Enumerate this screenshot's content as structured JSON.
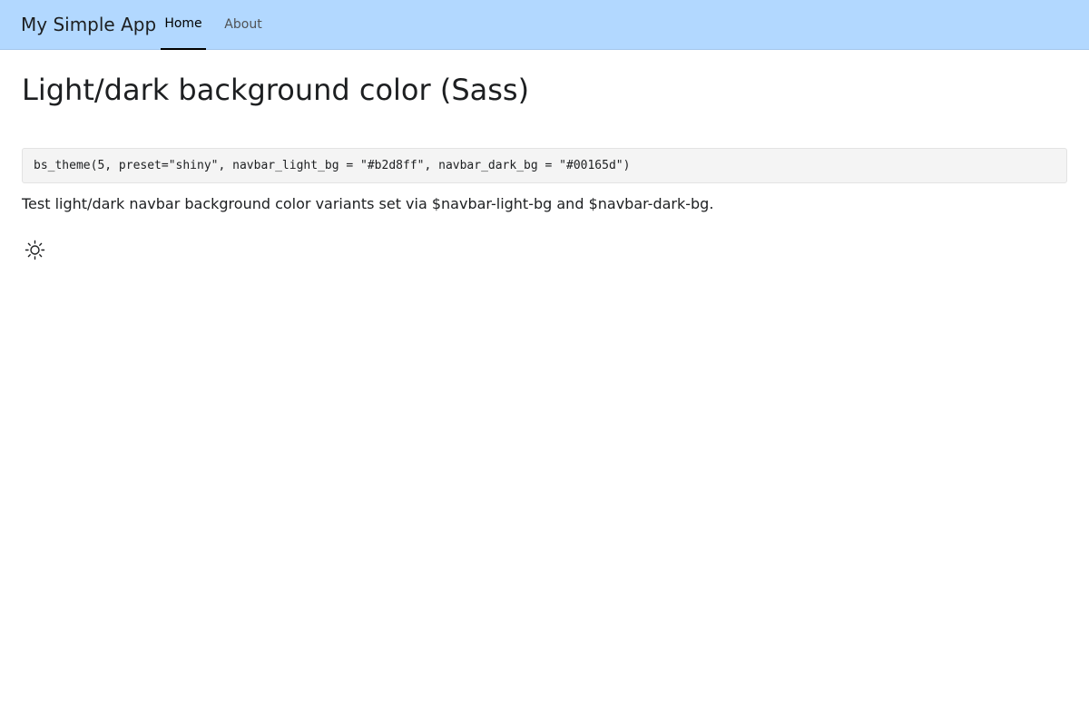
{
  "navbar": {
    "brand": "My Simple App",
    "background_color": "#b2d8ff",
    "tabs": [
      {
        "label": "Home",
        "active": true
      },
      {
        "label": "About",
        "active": false
      }
    ]
  },
  "main": {
    "title": "Light/dark background color (Sass)",
    "code": "bs_theme(5, preset=\"shiny\", navbar_light_bg = \"#b2d8ff\", navbar_dark_bg = \"#00165d\")",
    "description": "Test light/dark navbar background color variants set via $navbar-light-bg and $navbar-dark-bg.",
    "theme_toggle_icon": "sun-icon"
  }
}
